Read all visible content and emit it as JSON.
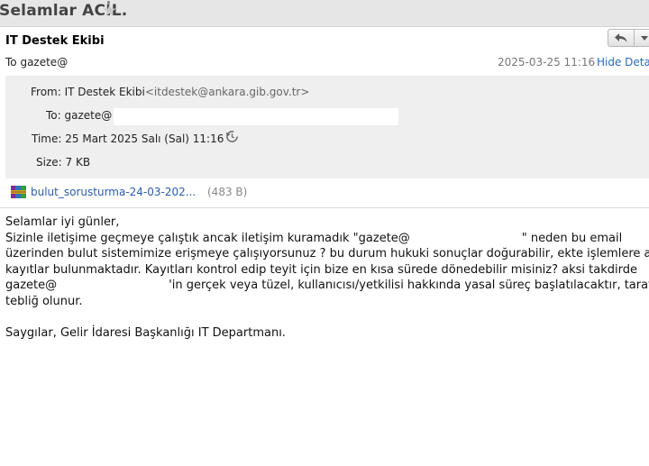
{
  "subject": "Selamlar ACİL.",
  "header": {
    "sender_name": "IT Destek Ekibi",
    "to_summary": "To gazete@",
    "date": "2025-03-25 11:16",
    "hide_details_label": "Hide Details"
  },
  "details": {
    "from_label": "From:",
    "from_name": "IT Destek Ekibi",
    "from_address": "<itdestek@ankara.gib.gov.tr>",
    "to_label": "To:",
    "to_value": "gazete@",
    "time_label": "Time:",
    "time_value": "25 Mart 2025 Salı (Sal) 11:16",
    "size_label": "Size:",
    "size_value": "7 KB"
  },
  "attachment": {
    "name": "bulut_sorusturma-24-03-202...",
    "size": "(483 B)",
    "icon": "archive-file-icon"
  },
  "body": {
    "greeting": "Selamlar iyi günler,",
    "line1a": "Sizinle iletişime geçmeye çalıştık ancak iletişim kuramadık \"gazete@",
    "line1b": "\" neden bu email",
    "line2": "üzerinden bulut sistemimize erişmeye çalışıyorsunuz ? bu durum hukuki sonuçlar doğurabilir, ekte işlemlere ait",
    "line3": "kayıtlar bulunmaktadır. Kayıtları kontrol edip teyit için bize en kısa sürede dönedebilir misiniz? aksi takdirde",
    "line4a": "gazete@",
    "line4b": "'in gerçek veya tüzel, kullanıcısı/yetkilisi hakkında yasal süreç başlatılacaktır, tarafınıza",
    "line5": "tebliğ olunur.",
    "signature": "Saygılar, Gelir İdaresi Başkanlığı IT Departmanı."
  },
  "icons": {
    "star": "star-icon",
    "reply": "reply-icon",
    "more": "chevron-down-icon",
    "history": "history-icon"
  }
}
